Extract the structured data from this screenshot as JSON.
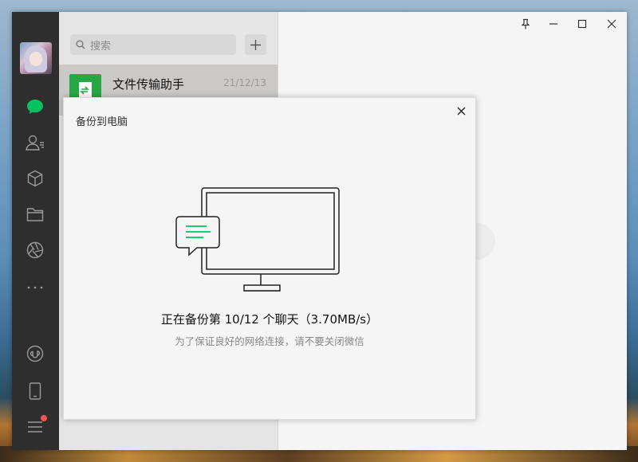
{
  "search": {
    "placeholder": "搜索"
  },
  "chat_list": [
    {
      "name": "文件传输助手",
      "date": "21/12/13"
    }
  ],
  "dialog": {
    "title": "备份到电脑",
    "status": "正在备份第 10/12 个聊天（3.70MB/s）",
    "hint": "为了保证良好的网络连接，请不要关闭微信"
  },
  "sidebar_icons": [
    "chat-icon",
    "contacts-icon",
    "favorites-icon",
    "files-icon",
    "moments-icon",
    "more-icon",
    "mini-programs-icon",
    "phone-icon",
    "menu-icon"
  ],
  "colors": {
    "accent": "#07c160",
    "sidebar": "#2e2e2e",
    "badge": "#fa5151"
  }
}
